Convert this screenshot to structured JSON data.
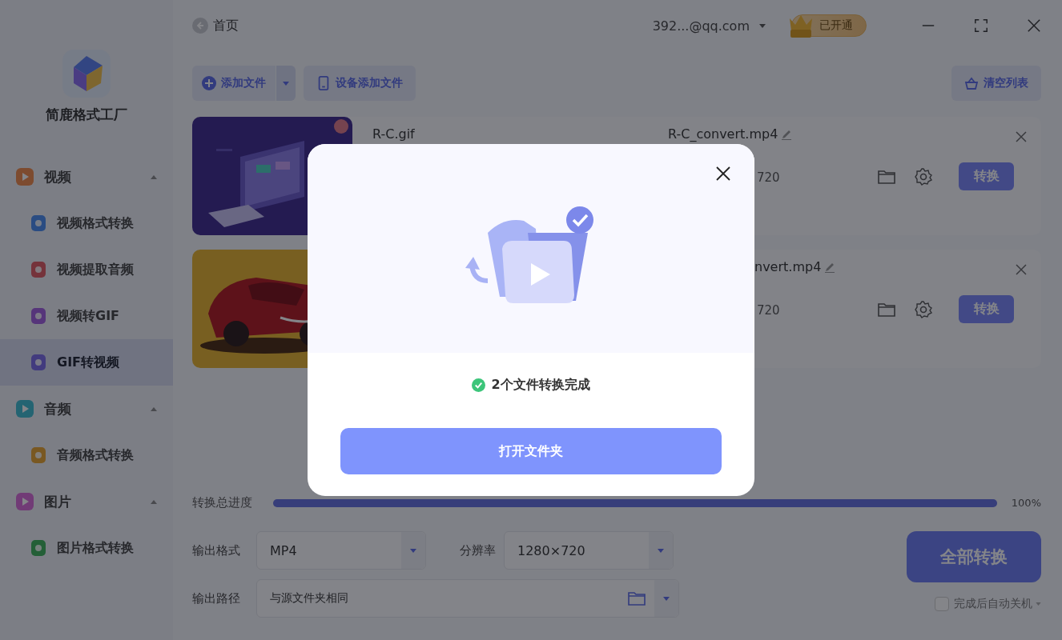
{
  "app": {
    "name": "简鹿格式工厂"
  },
  "sidebar": {
    "sections": [
      {
        "label": "视频",
        "expanded": true,
        "items": [
          {
            "label": "视频格式转换",
            "selected": false
          },
          {
            "label": "视频提取音频",
            "selected": false
          },
          {
            "label": "视频转GIF",
            "selected": false
          },
          {
            "label": "GIF转视频",
            "selected": true
          }
        ]
      },
      {
        "label": "音频",
        "expanded": true,
        "items": [
          {
            "label": "音频格式转换",
            "selected": false
          }
        ]
      },
      {
        "label": "图片",
        "expanded": true,
        "items": [
          {
            "label": "图片格式转换",
            "selected": false
          }
        ]
      }
    ]
  },
  "top_bar": {
    "back_label": "首页",
    "account": "392...@qq.com",
    "vip_label": "已开通"
  },
  "toolbar": {
    "add_files": "添加文件",
    "device_add": "设备添加文件",
    "clear_list": "清空列表"
  },
  "files": [
    {
      "source": "R-C.gif",
      "output": "R-C_convert.mp4",
      "detail": "720",
      "action": "转换"
    },
    {
      "output": "nvert.mp4",
      "detail": "720",
      "action": "转换"
    }
  ],
  "progress": {
    "label": "转换总进度",
    "level": 1,
    "reading": "100%"
  },
  "settings": {
    "format_label": "输出格式",
    "format": "MP4",
    "resolution_label": "分辨率",
    "resolution": "1280×720",
    "path_label": "输出路径",
    "path": "与源文件夹相同"
  },
  "convert_all": "全部转换",
  "shutdown": {
    "label": "完成后自动关机",
    "checked": false
  },
  "dialog": {
    "message": "2个文件转换完成",
    "button": "打开文件夹"
  }
}
